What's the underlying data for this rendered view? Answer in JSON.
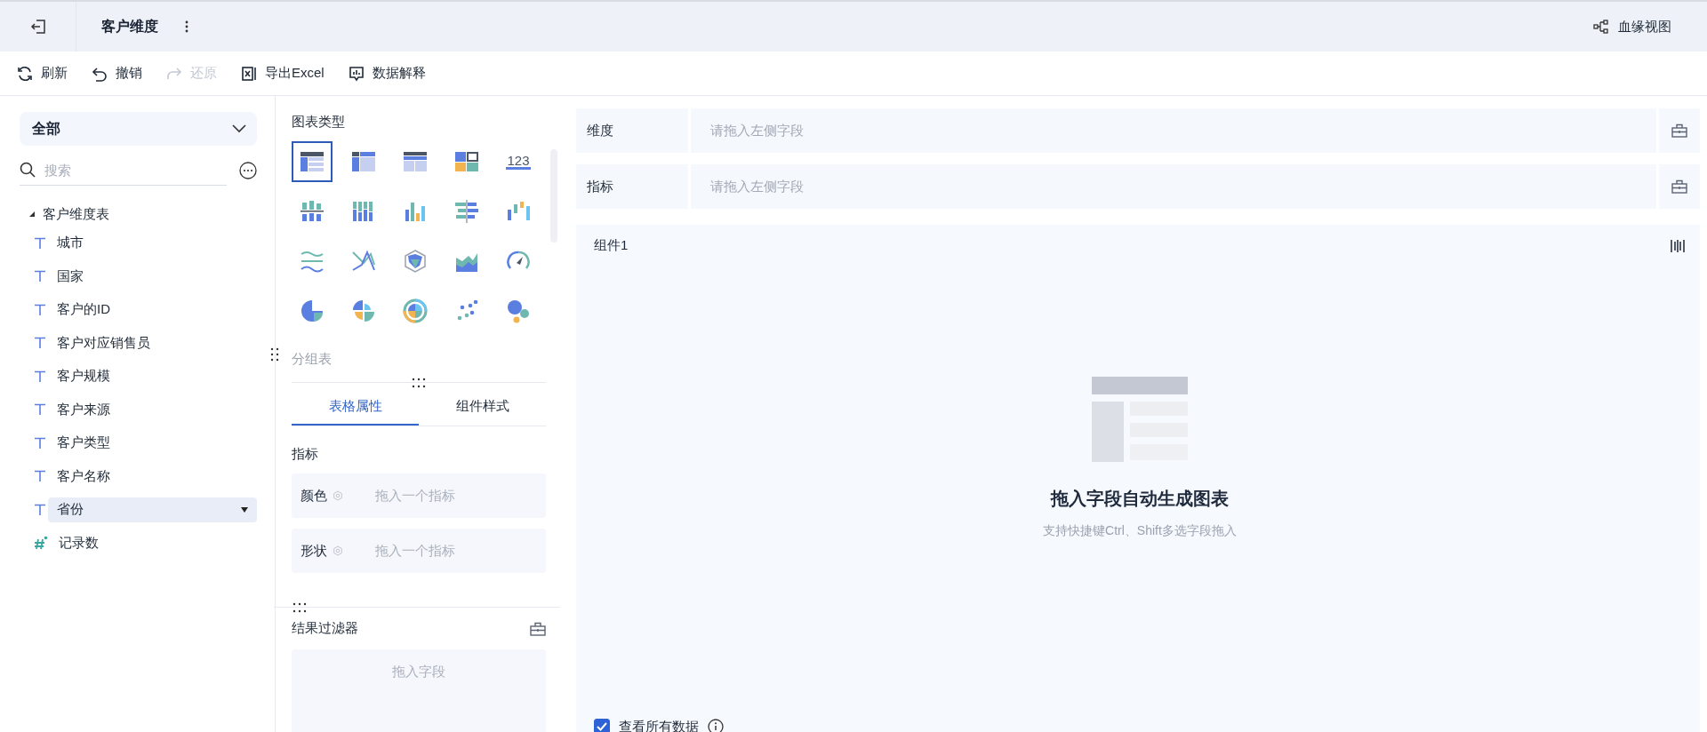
{
  "header": {
    "title": "客户维度",
    "lineage": "血缘视图"
  },
  "toolbar": [
    {
      "kind": "refresh",
      "label": "刷新",
      "disabled": false
    },
    {
      "kind": "undo",
      "label": "撤销",
      "disabled": false
    },
    {
      "kind": "redo",
      "label": "还原",
      "disabled": true
    },
    {
      "kind": "excel",
      "label": "导出Excel",
      "disabled": false
    },
    {
      "kind": "explain",
      "label": "数据解释",
      "disabled": false
    }
  ],
  "fields": {
    "scope": "全部",
    "search_placeholder": "搜索",
    "tree": [
      {
        "label": "客户维度表",
        "expanded": true,
        "children": [
          {
            "label": "城市",
            "kind": "text",
            "selected": false
          },
          {
            "label": "国家",
            "kind": "text",
            "selected": false
          },
          {
            "label": "客户的ID",
            "kind": "text",
            "selected": false
          },
          {
            "label": "客户对应销售员",
            "kind": "text",
            "selected": false
          },
          {
            "label": "客户规模",
            "kind": "text",
            "selected": false
          },
          {
            "label": "客户来源",
            "kind": "text",
            "selected": false
          },
          {
            "label": "客户类型",
            "kind": "text",
            "selected": false
          },
          {
            "label": "客户名称",
            "kind": "text",
            "selected": false
          },
          {
            "label": "省份",
            "kind": "text",
            "selected": true
          },
          {
            "label": "记录数",
            "kind": "number",
            "selected": false
          }
        ]
      }
    ]
  },
  "chart_types": {
    "title": "图表类型",
    "items": [
      {
        "kind": "table",
        "selected": true
      },
      {
        "kind": "cross-table",
        "selected": false
      },
      {
        "kind": "detail-table",
        "selected": false
      },
      {
        "kind": "treemap",
        "selected": false
      },
      {
        "kind": "number",
        "label": "123",
        "selected": false
      },
      {
        "kind": "grouped-bar",
        "selected": false
      },
      {
        "kind": "stacked-bar",
        "selected": false
      },
      {
        "kind": "bar",
        "selected": false
      },
      {
        "kind": "horizontal-bar",
        "selected": false
      },
      {
        "kind": "waterfall",
        "selected": false
      },
      {
        "kind": "wave",
        "selected": false
      },
      {
        "kind": "cross-line",
        "selected": false
      },
      {
        "kind": "radar",
        "selected": false
      },
      {
        "kind": "area",
        "selected": false
      },
      {
        "kind": "gauge",
        "selected": false
      },
      {
        "kind": "pie",
        "selected": false
      },
      {
        "kind": "rose",
        "selected": false
      },
      {
        "kind": "sunburst",
        "selected": false
      },
      {
        "kind": "scatter",
        "selected": false
      },
      {
        "kind": "bubble",
        "selected": false
      }
    ],
    "current": "分组表"
  },
  "properties": {
    "tabs": [
      {
        "label": "表格属性",
        "selected": true
      },
      {
        "label": "组件样式",
        "selected": false
      }
    ],
    "section": "指标",
    "rows": [
      {
        "label": "颜色",
        "placeholder": "拖入一个指标"
      },
      {
        "label": "形状",
        "placeholder": "拖入一个指标"
      }
    ]
  },
  "filter": {
    "title": "结果过滤器",
    "placeholder": "拖入字段"
  },
  "drop_rows": [
    {
      "label": "维度",
      "placeholder": "请拖入左侧字段"
    },
    {
      "label": "指标",
      "placeholder": "请拖入左侧字段"
    }
  ],
  "component": {
    "title": "组件1",
    "empty_title": "拖入字段自动生成图表",
    "empty_hint": "支持快捷键Ctrl、Shift多选字段拖入",
    "show_all": {
      "label": "查看所有数据",
      "checked": true
    }
  }
}
